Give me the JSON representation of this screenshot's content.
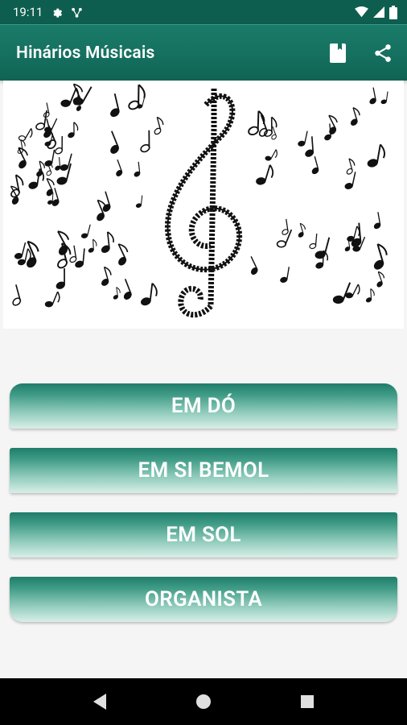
{
  "status_bar": {
    "time": "19:11",
    "icons": [
      "gear-icon",
      "network-share-icon",
      "wifi-icon",
      "signal-icon",
      "battery-icon"
    ]
  },
  "app_bar": {
    "title": "Hinários Músicais",
    "actions": [
      "book-icon",
      "share-icon"
    ]
  },
  "hero": {
    "image": "treble-clef-music-notes-illustration"
  },
  "buttons": [
    {
      "label": "EM DÓ"
    },
    {
      "label": "EM SI BEMOL"
    },
    {
      "label": "EM SOL"
    },
    {
      "label": "ORGANISTA"
    }
  ],
  "nav_bar": {
    "items": [
      "back-icon",
      "home-icon",
      "recents-icon"
    ]
  },
  "colors": {
    "app_bar": "#15705f",
    "status_bar": "#0e5e4f",
    "button_top": "#1e7d6a",
    "button_bottom": "#d8efe8",
    "background": "#f5f5f5"
  }
}
